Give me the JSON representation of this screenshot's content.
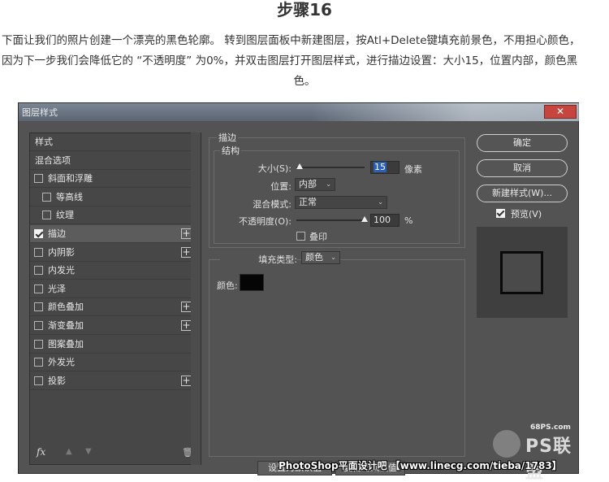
{
  "article": {
    "step_title": "步骤16",
    "paragraph_line1": "下面让我们的照片创建一个漂亮的黑色轮廓。 转到图层面板中新建图层，按Atl+Delete键填充前景色，不用担心颜色，",
    "paragraph_line2": "因为下一步我们会降低它的 “不透明度” 为0%，并双击图层打开图层样式，进行描边设置：大小15，位置内部，颜色黑",
    "paragraph_line3": "色。"
  },
  "dialog": {
    "title": "图层样式",
    "close_glyph": "✕",
    "styles_list": [
      {
        "label": "样式",
        "checkbox": false,
        "checked": false,
        "plus": false,
        "indent": 0,
        "active": false
      },
      {
        "label": "混合选项",
        "checkbox": false,
        "checked": false,
        "plus": false,
        "indent": 0,
        "active": false
      },
      {
        "label": "斜面和浮雕",
        "checkbox": true,
        "checked": false,
        "plus": false,
        "indent": 0,
        "active": false
      },
      {
        "label": "等高线",
        "checkbox": true,
        "checked": false,
        "plus": false,
        "indent": 1,
        "active": false
      },
      {
        "label": "纹理",
        "checkbox": true,
        "checked": false,
        "plus": false,
        "indent": 1,
        "active": false
      },
      {
        "label": "描边",
        "checkbox": true,
        "checked": true,
        "plus": true,
        "indent": 0,
        "active": true
      },
      {
        "label": "内阴影",
        "checkbox": true,
        "checked": false,
        "plus": true,
        "indent": 0,
        "active": false
      },
      {
        "label": "内发光",
        "checkbox": true,
        "checked": false,
        "plus": false,
        "indent": 0,
        "active": false
      },
      {
        "label": "光泽",
        "checkbox": true,
        "checked": false,
        "plus": false,
        "indent": 0,
        "active": false
      },
      {
        "label": "颜色叠加",
        "checkbox": true,
        "checked": false,
        "plus": true,
        "indent": 0,
        "active": false
      },
      {
        "label": "渐变叠加",
        "checkbox": true,
        "checked": false,
        "plus": true,
        "indent": 0,
        "active": false
      },
      {
        "label": "图案叠加",
        "checkbox": true,
        "checked": false,
        "plus": false,
        "indent": 0,
        "active": false
      },
      {
        "label": "外发光",
        "checkbox": true,
        "checked": false,
        "plus": false,
        "indent": 0,
        "active": false
      },
      {
        "label": "投影",
        "checkbox": true,
        "checked": false,
        "plus": true,
        "indent": 0,
        "active": false
      }
    ],
    "footer": {
      "fx": "fx",
      "fx_sub": "˅",
      "up": "▲",
      "down": "▼",
      "trash": "🗑"
    },
    "stroke": {
      "section_title": "描边",
      "structure_title": "结构",
      "size_label": "大小(S):",
      "size_value": "15",
      "size_unit": "像素",
      "size_slider_fraction": 0.05,
      "position_label": "位置:",
      "position_value": "内部",
      "blend_label": "混合模式:",
      "blend_value": "正常",
      "opacity_label": "不透明度(O):",
      "opacity_value": "100",
      "opacity_unit": "%",
      "opacity_slider_fraction": 1.0,
      "overprint_label": "叠印",
      "fill_type_label": "填充类型:",
      "fill_type_value": "颜色",
      "color_label": "颜色:",
      "color_value": "#050505",
      "make_default": "设置为默认值",
      "reset_default": "复位为默认值"
    },
    "buttons": {
      "ok": "确定",
      "cancel": "取消",
      "new_style": "新建样式(W)...",
      "preview_label": "预览(V)"
    },
    "watermark": {
      "site": "68PS.com",
      "brand": "PS联盟"
    }
  },
  "footer_credit": "PhotoShop平面设计吧 【www.linecg.com/tieba/1783】"
}
